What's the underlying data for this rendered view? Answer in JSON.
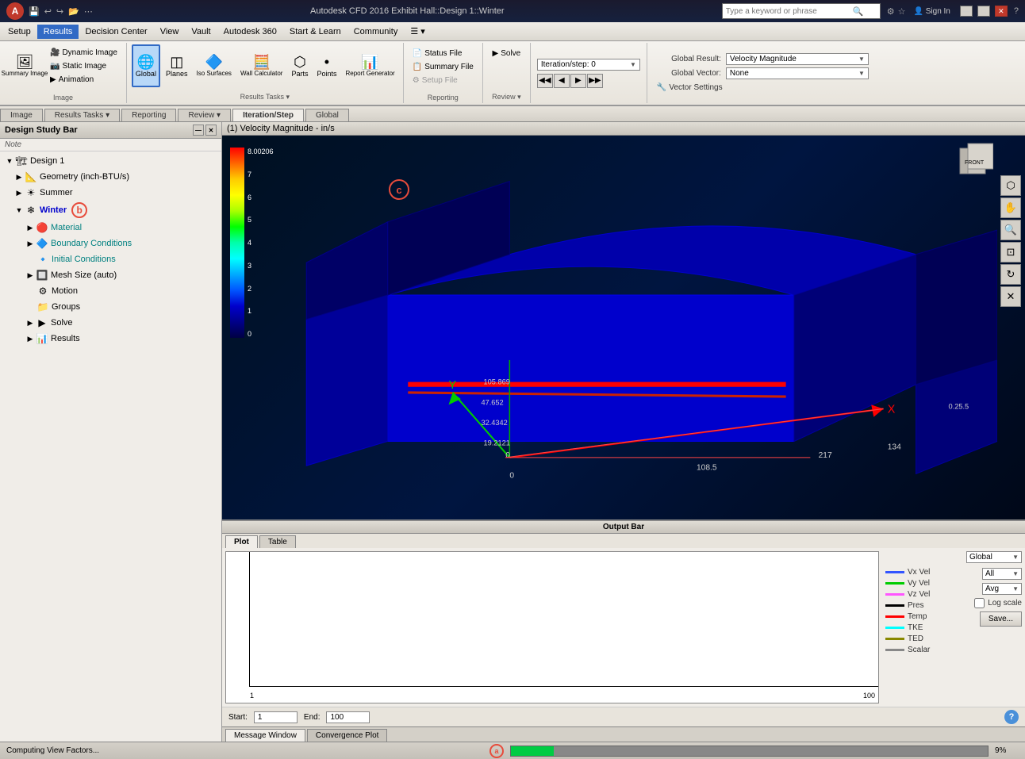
{
  "app": {
    "title": "Autodesk CFD 2016  Exhibit Hall::Design 1::Winter",
    "logo_text": "A"
  },
  "search": {
    "placeholder": "Type a keyword or phrase"
  },
  "title_buttons": {
    "sign_in": "Sign In",
    "minimize": "—",
    "maximize": "□",
    "close": "✕"
  },
  "menu": {
    "items": [
      "Setup",
      "Results",
      "Decision Center",
      "View",
      "Vault",
      "Autodesk 360",
      "Start & Learn",
      "Community",
      "☰"
    ]
  },
  "toolbar": {
    "image_group": {
      "label": "Image",
      "dynamic_image": "Dynamic Image",
      "static_image": "Static Image",
      "animation": "Animation",
      "summary_image": "Summary Image"
    },
    "results_tasks": {
      "label": "Results Tasks ▾",
      "global": "Global",
      "planes": "Planes",
      "iso_surfaces": "Iso Surfaces",
      "wall_calculator": "Wall Calculator",
      "parts": "Parts",
      "points": "Points",
      "report_generator": "Report Generator"
    },
    "reporting": {
      "label": "Reporting",
      "status_file": "Status File",
      "summary_file": "Summary File",
      "setup_file": "Setup File"
    },
    "review": {
      "label": "Review ▾",
      "solve": "Solve"
    },
    "iteration_step": {
      "label": "Iteration/Step",
      "iteration_label": "Iteration/step: 0",
      "nav_prev_prev": "◀◀",
      "nav_prev": "◀",
      "nav_next": "▶",
      "nav_next_next": "▶▶"
    },
    "global_result": {
      "section_label": "Global",
      "result_label": "Global Result:",
      "result_value": "Velocity Magnitude",
      "vector_label": "Global Vector:",
      "vector_value": "None",
      "vector_settings": "Vector Settings"
    }
  },
  "sidebar": {
    "title": "Design Study Bar",
    "note_label": "Note",
    "tree": [
      {
        "id": "design1",
        "label": "Design 1",
        "level": 0,
        "type": "design",
        "expanded": true
      },
      {
        "id": "geometry",
        "label": "Geometry (inch-BTU/s)",
        "level": 1,
        "type": "geometry",
        "expanded": false
      },
      {
        "id": "summer",
        "label": "Summer",
        "level": 1,
        "type": "scenario",
        "expanded": false
      },
      {
        "id": "winter",
        "label": "Winter",
        "level": 1,
        "type": "scenario",
        "expanded": true,
        "selected": true,
        "bold": true
      },
      {
        "id": "material",
        "label": "Material",
        "level": 2,
        "type": "material"
      },
      {
        "id": "boundary",
        "label": "Boundary Conditions",
        "level": 2,
        "type": "boundary"
      },
      {
        "id": "initial",
        "label": "Initial Conditions",
        "level": 2,
        "type": "initial"
      },
      {
        "id": "mesh",
        "label": "Mesh Size (auto)",
        "level": 2,
        "type": "mesh",
        "expandable": true
      },
      {
        "id": "motion",
        "label": "Motion",
        "level": 2,
        "type": "motion"
      },
      {
        "id": "groups",
        "label": "Groups",
        "level": 2,
        "type": "groups"
      },
      {
        "id": "solve",
        "label": "Solve",
        "level": 2,
        "type": "solve",
        "expandable": true
      },
      {
        "id": "results",
        "label": "Results",
        "level": 2,
        "type": "results",
        "expandable": true
      }
    ]
  },
  "viewport": {
    "title": "(1) Velocity Magnitude - in/s",
    "color_scale": {
      "max_value": "8.00206",
      "labels": [
        "8.00206",
        "7",
        "6",
        "5",
        "4",
        "3",
        "2",
        "1",
        "0"
      ]
    },
    "annotations": {
      "b": "b",
      "c": "c"
    },
    "dimension_labels": [
      "105.869",
      "47.652",
      "32.4342",
      "19.2121",
      "134",
      "217",
      "108.5",
      "0",
      "Y",
      "X"
    ]
  },
  "output_bar": {
    "title": "Output Bar",
    "tabs": [
      "Plot",
      "Table"
    ],
    "active_tab": "Plot",
    "plot": {
      "x_start": "1",
      "x_end": "100"
    },
    "legend": {
      "items": [
        {
          "label": "Vx Vel",
          "color": "#3355ff"
        },
        {
          "label": "Vy Vel",
          "color": "#00cc00"
        },
        {
          "label": "Vz Vel",
          "color": "#ff55ff"
        },
        {
          "label": "Pres",
          "color": "#000000"
        },
        {
          "label": "Temp",
          "color": "#ff0000"
        },
        {
          "label": "TKE",
          "color": "#00ffff"
        },
        {
          "label": "TED",
          "color": "#888800"
        },
        {
          "label": "Scalar",
          "color": "#888888"
        }
      ],
      "dropdowns": [
        {
          "label": "",
          "value": "Global"
        },
        {
          "label": "",
          "value": "All"
        },
        {
          "label": "",
          "value": "Avg"
        }
      ],
      "log_scale_label": "Log scale",
      "save_label": "Save..."
    },
    "start_label": "Start:",
    "start_value": "1",
    "end_label": "End:",
    "end_value": "100"
  },
  "bottom_tabs": [
    "Message Window",
    "Convergence Plot"
  ],
  "status": {
    "text": "Computing View Factors...",
    "annotation_a": "a",
    "progress_value": 9,
    "progress_text": "9%"
  }
}
